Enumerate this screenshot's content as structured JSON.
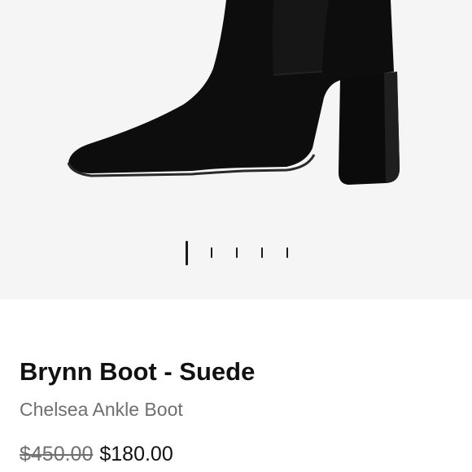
{
  "gallery": {
    "image_subject": "black suede chelsea ankle boot",
    "indicator_count": 5,
    "active_index": 0,
    "background_color": "#f6f5f5",
    "product_color": "#0d0d0d"
  },
  "product": {
    "title": "Brynn Boot - Suede",
    "subtitle": "Chelsea Ankle Boot",
    "original_price": "$450.00",
    "sale_price": "$180.00"
  }
}
